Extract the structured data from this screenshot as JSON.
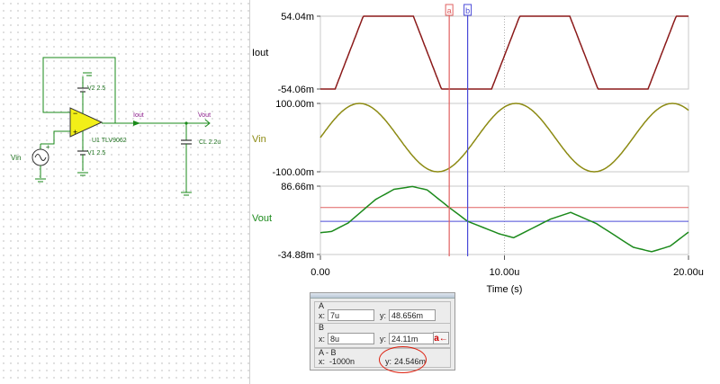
{
  "colors": {
    "iout": "#8b1a1a",
    "vin": "#8c8a12",
    "vout": "#1c8a1c",
    "cursor_a": "#e06060",
    "cursor_b": "#4a4ad8",
    "grid": "#c8c8c8",
    "opamp_fill": "#f2ef18",
    "wire": "#1a8a1a",
    "component": "#1c6f1c",
    "net_label": "#8a1a8a"
  },
  "schematic": {
    "opamp_label": "U1 TLV9062",
    "v2_label": "V2 2.5",
    "v1_label": "V1 2.5",
    "vin_label": "Vin",
    "iout_label": "Iout",
    "vout_label": "Vout",
    "cap_label": "CL 2.2u",
    "plus_sign": "+",
    "minus_sign": "−"
  },
  "chart_data": {
    "type": "line",
    "xlabel": "Time (s)",
    "x_ticks": [
      "0.00",
      "10.00u",
      "20.00u"
    ],
    "x_range": [
      0,
      20
    ],
    "cursors": [
      {
        "name": "a",
        "x": 7
      },
      {
        "name": "b",
        "x": 8
      }
    ],
    "panels": [
      {
        "name": "Iout",
        "ylim": [
          -54.06,
          54.04
        ],
        "ytick_labels": [
          "54.04m",
          "-54.06m"
        ],
        "shape": "clipped-triangle",
        "period": 8.5,
        "phase": 0.8
      },
      {
        "name": "Vin",
        "ylim": [
          -100,
          100
        ],
        "ytick_labels": [
          "100.00m",
          "-100.00m"
        ],
        "shape": "sine",
        "amplitude": 100,
        "period": 8.5,
        "phase": 0
      },
      {
        "name": "Vout",
        "ylim": [
          -34.88,
          86.66
        ],
        "ytick_labels": [
          "86.66m",
          "-34.88m"
        ],
        "shape": "rounded-triangle",
        "period": 8.5,
        "series_points": [
          [
            0,
            4
          ],
          [
            0.6,
            6
          ],
          [
            1.5,
            21
          ],
          [
            3,
            63
          ],
          [
            4,
            81
          ],
          [
            5,
            86
          ],
          [
            5.8,
            80
          ],
          [
            7,
            48.656
          ],
          [
            8,
            24.11
          ],
          [
            9.7,
            2
          ],
          [
            10.5,
            -5
          ],
          [
            12.5,
            28
          ],
          [
            13.6,
            40
          ],
          [
            15,
            20
          ],
          [
            17,
            -22
          ],
          [
            18,
            -30
          ],
          [
            19,
            -20
          ],
          [
            20,
            5
          ]
        ],
        "cursor_a_level": 48.656,
        "cursor_b_level": 24.11
      }
    ],
    "cursor_readout": {
      "a_title": "A",
      "a_x_label": "x:",
      "a_x": "7u",
      "a_y_label": "y:",
      "a_y": "48.656m",
      "b_title": "B",
      "b_x_label": "x:",
      "b_x": "8u",
      "b_y_label": "y:",
      "b_y": "24.11m",
      "diff_title": "A - B",
      "diff_x_label": "x:",
      "diff_x": "-1000n",
      "diff_y_label": "y:",
      "diff_y": "24.546m",
      "set_button_glyph": "a←"
    }
  }
}
